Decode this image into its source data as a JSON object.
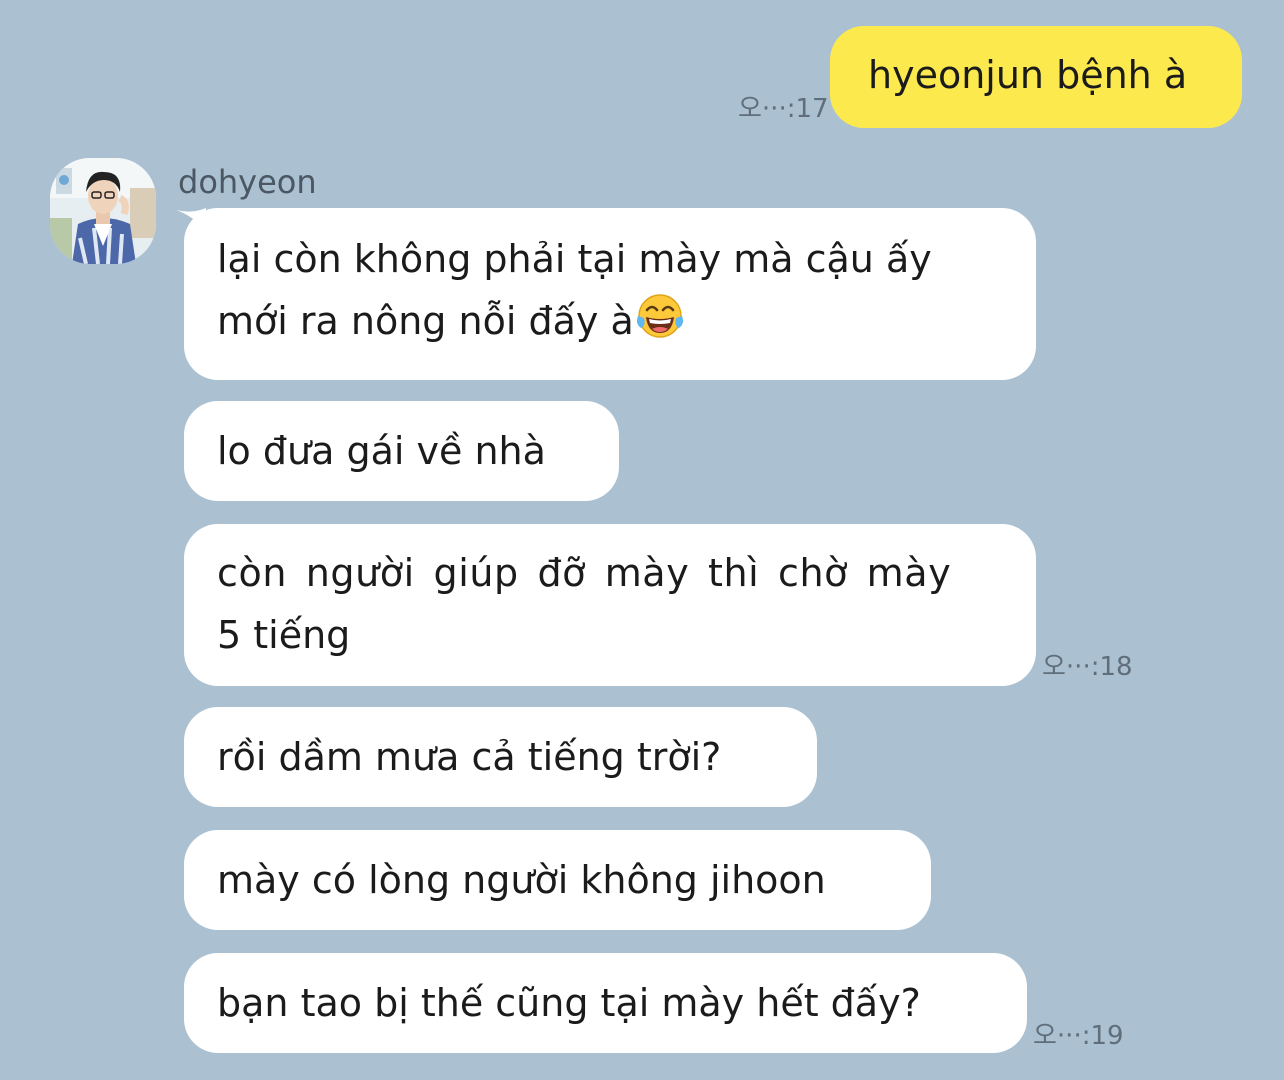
{
  "outgoing": {
    "text": "hyeonjun bệnh à",
    "time": "오···:17"
  },
  "sender": {
    "name": "dohyeon"
  },
  "incoming": [
    {
      "lines": [
        "lại còn không phải tại mày mà cậu ấy",
        "mới ra nông nỗi đấy à"
      ],
      "emoji": "tears-of-joy-emoji"
    },
    {
      "lines": [
        "lo đưa gái về nhà"
      ]
    },
    {
      "lines": [
        "còn người giúp đỡ mày thì chờ mày",
        "5 tiếng"
      ],
      "time": "오···:18"
    },
    {
      "lines": [
        "rồi dầm mưa cả tiếng trời?"
      ]
    },
    {
      "lines": [
        "mày có lòng người không jihoon"
      ]
    },
    {
      "lines": [
        "bạn tao bị thế cũng tại mày hết đấy?"
      ],
      "time": "오···:19"
    }
  ],
  "colors": {
    "background": "#abc1d1",
    "outgoing_bubble": "#fbe94e",
    "incoming_bubble": "#ffffff",
    "time_text": "#5f6e7a"
  }
}
